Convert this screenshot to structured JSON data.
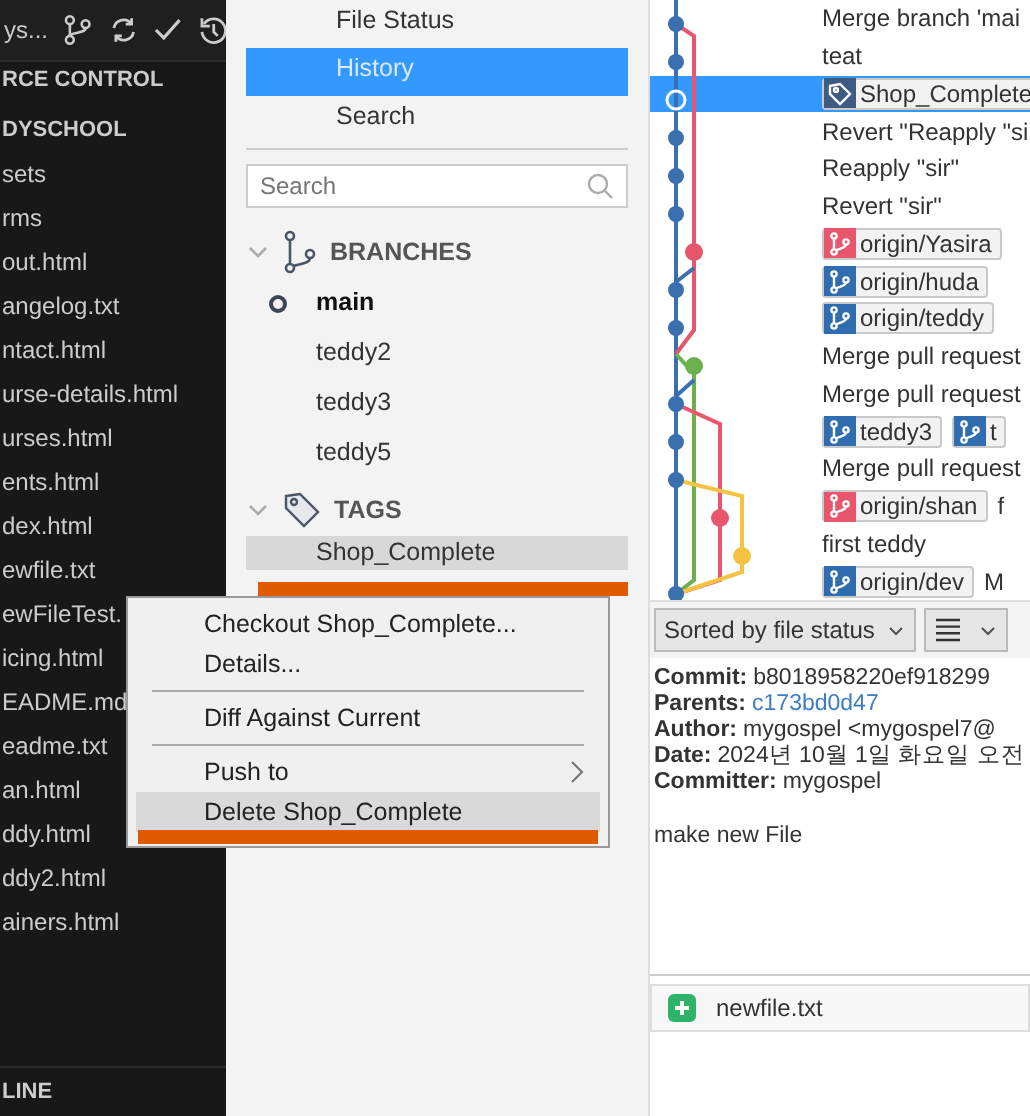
{
  "explorer": {
    "title": "ys...",
    "header": "RCE CONTROL",
    "repo": "DYSCHOOL",
    "files": [
      "sets",
      "rms",
      "out.html",
      "angelog.txt",
      "ntact.html",
      "urse-details.html",
      "urses.html",
      "ents.html",
      "dex.html",
      "ewfile.txt",
      "ewFileTest.",
      "icing.html",
      "EADME.md",
      "eadme.txt",
      "an.html",
      "ddy.html",
      "ddy2.html",
      "ainers.html"
    ],
    "footer": "LINE"
  },
  "nav": [
    {
      "label": "File Status",
      "selected": false
    },
    {
      "label": "History",
      "selected": true
    },
    {
      "label": "Search",
      "selected": false
    }
  ],
  "search": {
    "placeholder": "Search"
  },
  "branches": {
    "title": "BRANCHES",
    "expanded": true,
    "items": [
      {
        "label": "main",
        "current": true
      },
      {
        "label": "teddy2",
        "current": false
      },
      {
        "label": "teddy3",
        "current": false
      },
      {
        "label": "teddy5",
        "current": false
      }
    ]
  },
  "tags": {
    "title": "TAGS",
    "expanded": true,
    "items": [
      {
        "label": "Shop_Complete",
        "highlighted": true
      }
    ]
  },
  "commits": [
    {
      "message": "Merge branch 'mai",
      "selected": false
    },
    {
      "message": "teat",
      "selected": false
    },
    {
      "refs": [
        {
          "kind": "tag",
          "label": "Shop_Complete",
          "color": "#3d5b83"
        }
      ],
      "selected": true
    },
    {
      "message": "Revert \"Reapply \"si",
      "selected": false
    },
    {
      "message": "Reapply \"sir\"",
      "selected": false
    },
    {
      "message": "Revert \"sir\"",
      "selected": false
    },
    {
      "refs": [
        {
          "kind": "branch",
          "label": "origin/Yasira",
          "color": "#e8566e"
        }
      ],
      "selected": false
    },
    {
      "refs": [
        {
          "kind": "branch",
          "label": "origin/huda",
          "color": "#2f6cb0"
        }
      ],
      "selected": false
    },
    {
      "refs": [
        {
          "kind": "branch",
          "label": "origin/teddy",
          "color": "#2f6cb0"
        }
      ],
      "selected": false
    },
    {
      "message": "Merge pull request",
      "selected": false
    },
    {
      "message": "Merge pull request",
      "selected": false
    },
    {
      "refs": [
        {
          "kind": "branch",
          "label": "teddy3",
          "color": "#2f6cb0"
        },
        {
          "kind": "branch",
          "label": "t",
          "color": "#2f6cb0"
        }
      ],
      "selected": false
    },
    {
      "message": "Merge pull request",
      "selected": false
    },
    {
      "refs": [
        {
          "kind": "branch",
          "label": "origin/shan",
          "color": "#e8566e"
        }
      ],
      "message": "f",
      "selected": false
    },
    {
      "message": "first teddy",
      "selected": false
    },
    {
      "refs": [
        {
          "kind": "branch",
          "label": "origin/dev",
          "color": "#2f6cb0"
        }
      ],
      "message": "M",
      "selected": false
    }
  ],
  "toolbar": {
    "sort": "Sorted by file status"
  },
  "details": [
    {
      "label": "Commit:",
      "value": "b8018958220ef918299",
      "kind": "text"
    },
    {
      "label": "Parents:",
      "value": "c173bd0d47",
      "kind": "link"
    },
    {
      "label": "Author:",
      "value": "mygospel <mygospel7@",
      "kind": "text"
    },
    {
      "label": "Date:",
      "value": "2024년 10월 1일 화요일 오전",
      "kind": "text"
    },
    {
      "label": "Committer:",
      "value": "mygospel",
      "kind": "text"
    }
  ],
  "message": "make new File",
  "files": [
    {
      "name": "newfile.txt",
      "added": true
    }
  ],
  "context_menu": [
    {
      "kind": "item",
      "label": "Checkout Shop_Complete...",
      "selected": false
    },
    {
      "kind": "item",
      "label": "Details...",
      "selected": false
    },
    {
      "kind": "separator"
    },
    {
      "kind": "item",
      "label": "Diff Against Current",
      "selected": false
    },
    {
      "kind": "separator"
    },
    {
      "kind": "submenu",
      "label": "Push to",
      "selected": false
    },
    {
      "kind": "item",
      "label": "Delete Shop_Complete",
      "selected": true
    }
  ]
}
